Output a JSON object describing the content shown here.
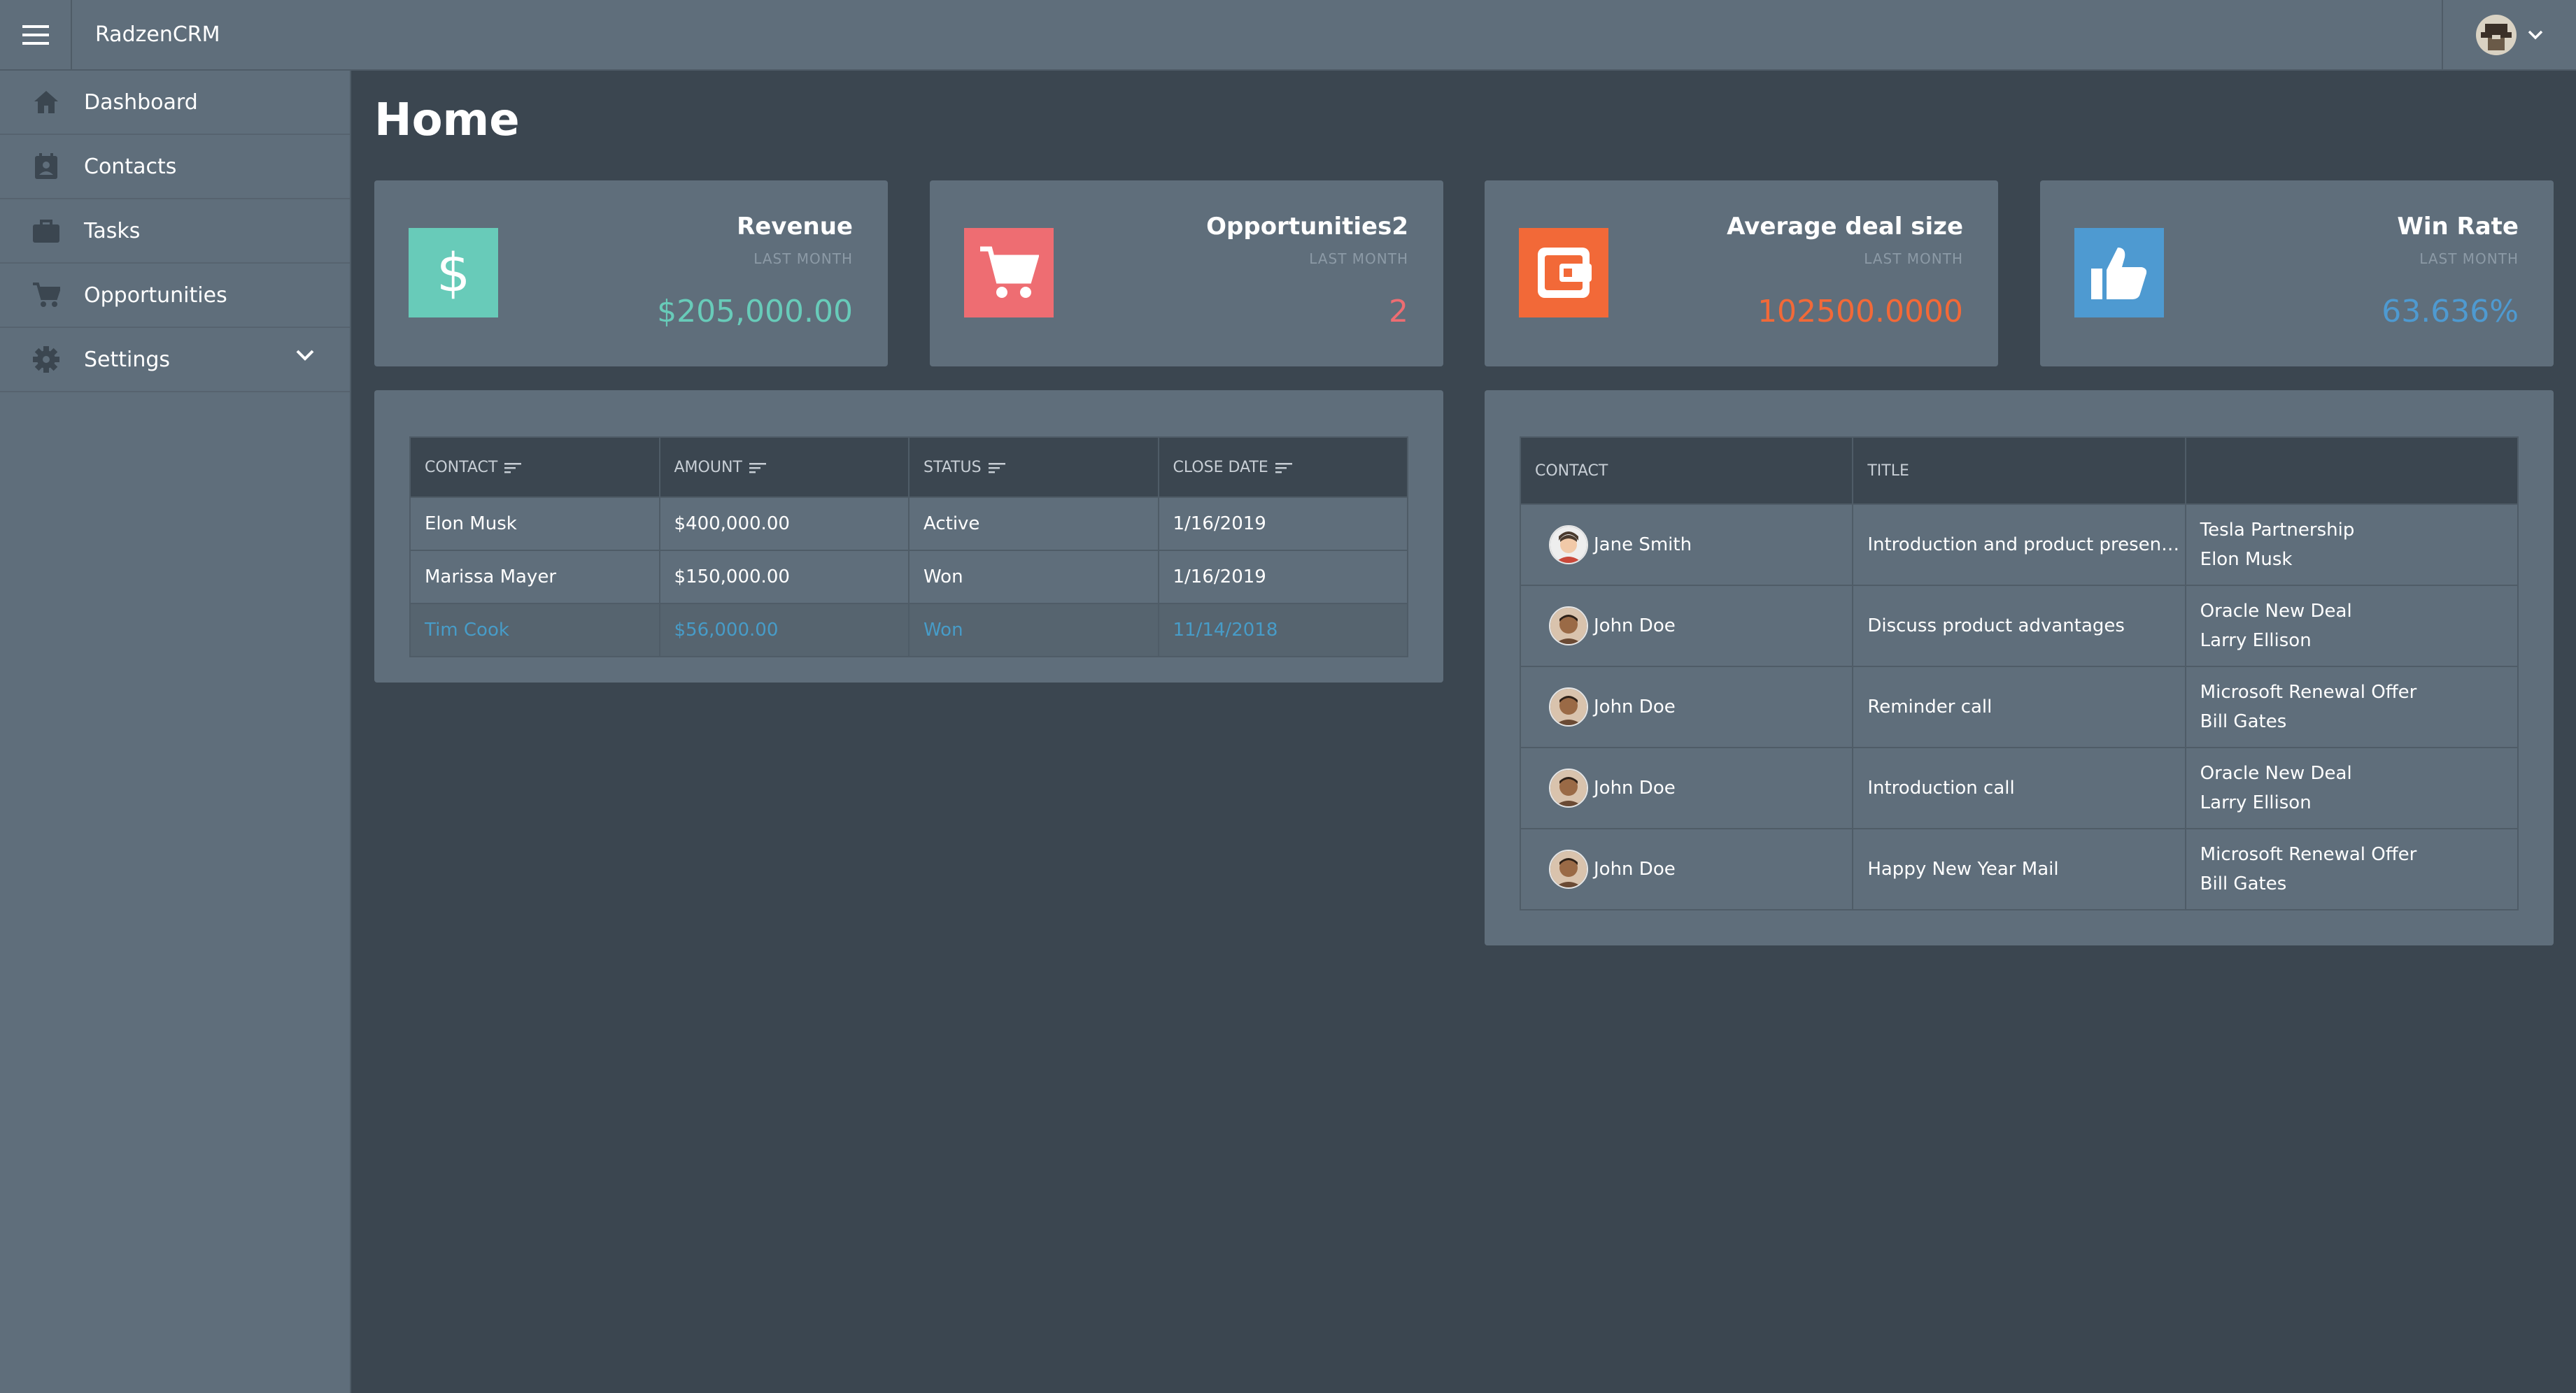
{
  "app": {
    "title": "RadzenCRM"
  },
  "sidebar": {
    "items": [
      {
        "label": "Dashboard",
        "icon": "home-icon"
      },
      {
        "label": "Contacts",
        "icon": "contacts-icon"
      },
      {
        "label": "Tasks",
        "icon": "briefcase-icon"
      },
      {
        "label": "Opportunities",
        "icon": "cart-icon"
      },
      {
        "label": "Settings",
        "icon": "gear-icon"
      }
    ]
  },
  "page": {
    "title": "Home"
  },
  "cards": [
    {
      "title": "Revenue",
      "subtitle": "LAST MONTH",
      "value": "$205,000.00",
      "color": "#68cbb9",
      "icon": "dollar-icon"
    },
    {
      "title": "Opportunities2",
      "subtitle": "LAST MONTH",
      "value": "2",
      "color": "#ee6d72",
      "icon": "cart-icon"
    },
    {
      "title": "Average deal size",
      "subtitle": "LAST MONTH",
      "value": "102500.0000",
      "color": "#f26938",
      "icon": "wallet-icon"
    },
    {
      "title": "Win Rate",
      "subtitle": "LAST MONTH",
      "value": "63.636%",
      "color": "#4e9ad1",
      "icon": "thumbs-up-icon"
    }
  ],
  "opportunities_grid": {
    "columns": [
      "CONTACT",
      "AMOUNT",
      "STATUS",
      "CLOSE DATE"
    ],
    "rows": [
      [
        "Elon Musk",
        "$400,000.00",
        "Active",
        "1/16/2019"
      ],
      [
        "Marissa Mayer",
        "$150,000.00",
        "Won",
        "1/16/2019"
      ],
      [
        "Tim Cook",
        "$56,000.00",
        "Won",
        "11/14/2018"
      ]
    ],
    "selected_row": 2
  },
  "tasks_grid": {
    "columns": [
      "CONTACT",
      "TITLE",
      ""
    ],
    "rows": [
      {
        "contact": "Jane Smith",
        "title": "Introduction and product presenta...",
        "deal": "Tesla Partnership",
        "person": "Elon Musk"
      },
      {
        "contact": "John Doe",
        "title": "Discuss product advantages",
        "deal": "Oracle New Deal",
        "person": "Larry Ellison"
      },
      {
        "contact": "John Doe",
        "title": "Reminder call",
        "deal": "Microsoft Renewal Offer",
        "person": "Bill Gates"
      },
      {
        "contact": "John Doe",
        "title": "Introduction call",
        "deal": "Oracle New Deal",
        "person": "Larry Ellison"
      },
      {
        "contact": "John Doe",
        "title": "Happy New Year Mail",
        "deal": "Microsoft Renewal Offer",
        "person": "Bill Gates"
      }
    ]
  },
  "colors": {
    "header": "#5f6e7b",
    "background": "#3b4650",
    "selected_text": "#479cc8"
  }
}
